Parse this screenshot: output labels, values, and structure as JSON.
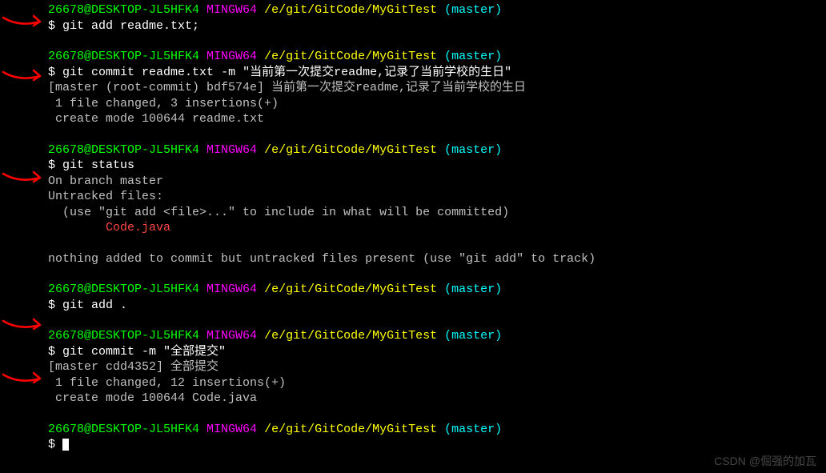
{
  "prompt": {
    "user_host": "26678@DESKTOP-JL5HFK4",
    "shell": "MINGW64",
    "path": "/e/git/GitCode/MyGitTest",
    "branch": "(master)",
    "symbol": "$"
  },
  "commands": {
    "add_readme": "git add readme.txt;",
    "commit_readme": "git commit readme.txt -m \"当前第一次提交readme,记录了当前学校的生日\"",
    "status": "git status",
    "add_all": "git add .",
    "commit_all": "git commit -m \"全部提交\""
  },
  "output": {
    "commit1_line1": "[master (root-commit) bdf574e] 当前第一次提交readme,记录了当前学校的生日",
    "commit1_line2": " 1 file changed, 3 insertions(+)",
    "commit1_line3": " create mode 100644 readme.txt",
    "status_line1": "On branch master",
    "status_line2": "Untracked files:",
    "status_line3": "  (use \"git add <file>...\" to include in what will be committed)",
    "status_untracked": "        Code.java",
    "status_line5": "nothing added to commit but untracked files present (use \"git add\" to track)",
    "commit2_line1": "[master cdd4352] 全部提交",
    "commit2_line2": " 1 file changed, 12 insertions(+)",
    "commit2_line3": " create mode 100644 Code.java"
  },
  "watermark": "CSDN @倔强的加瓦"
}
